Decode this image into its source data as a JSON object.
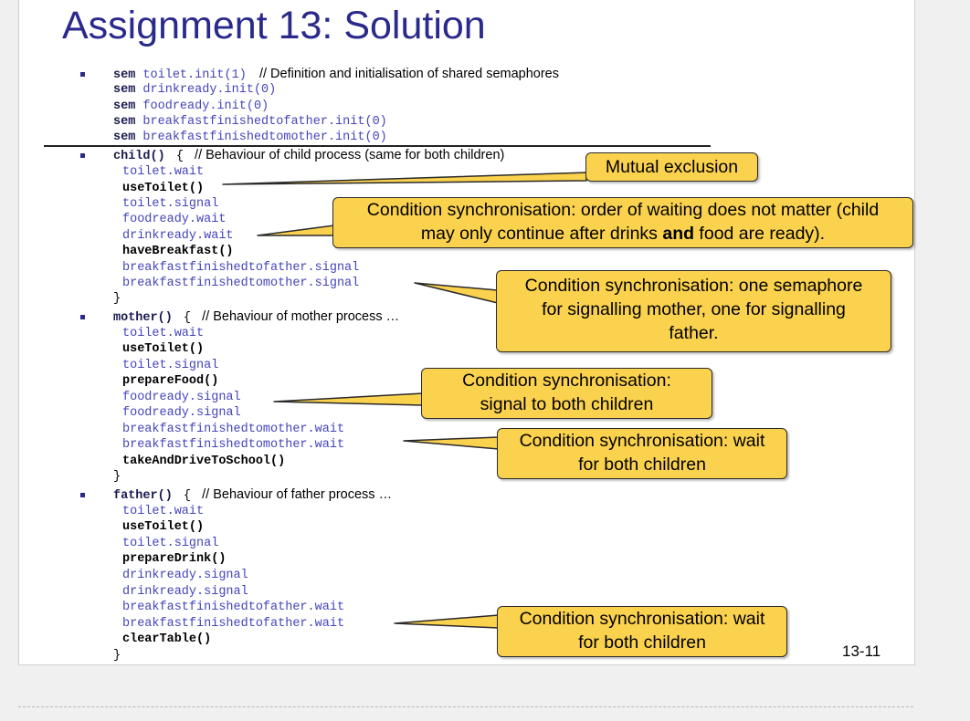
{
  "title": "Assignment 13: Solution",
  "page_number": "13-11",
  "semaphores": {
    "kw": "sem",
    "decl": [
      "toilet.init(1)",
      "drinkready.init(0)",
      "foodready.init(0)",
      "breakfastfinishedtofather.init(0)",
      "breakfastfinishedtomother.init(0)"
    ],
    "comment": "// Definition and initialisation of shared semaphores"
  },
  "child": {
    "header": "child()",
    "brace": "{",
    "comment": "// Behaviour of child process (same for both children)",
    "lines": [
      "toilet.wait",
      "useToilet()",
      "toilet.signal",
      "foodready.wait",
      "drinkready.wait",
      "haveBreakfast()",
      "breakfastfinishedtofather.signal",
      "breakfastfinishedtomother.signal"
    ],
    "close": "}"
  },
  "mother": {
    "header": "mother()",
    "brace": "{",
    "comment": "// Behaviour of mother process …",
    "lines": [
      "toilet.wait",
      "useToilet()",
      "toilet.signal",
      "prepareFood()",
      "foodready.signal",
      "foodready.signal",
      "breakfastfinishedtomother.wait",
      "breakfastfinishedtomother.wait",
      "takeAndDriveToSchool()"
    ],
    "close": "}"
  },
  "father": {
    "header": "father()",
    "brace": "{",
    "comment": "// Behaviour of father process …",
    "lines": [
      "toilet.wait",
      "useToilet()",
      "toilet.signal",
      "prepareDrink()",
      "drinkready.signal",
      "drinkready.signal",
      "breakfastfinishedtofather.wait",
      "breakfastfinishedtofather.wait",
      "clearTable()"
    ],
    "close": "}"
  },
  "callouts": {
    "mutual": "Mutual exclusion",
    "order_a": "Condition synchronisation: order of waiting does not matter (child",
    "order_b": "may only continue after drinks ",
    "order_bold": "and",
    "order_c": " food are ready).",
    "sema_1": "Condition synchronisation: one semaphore",
    "sema_2": "for signalling mother, one for signalling",
    "sema_3": "father.",
    "signal_1": "Condition synchronisation:",
    "signal_2": "signal to both children",
    "wait_m_1": "Condition synchronisation: wait",
    "wait_m_2": "for both children",
    "wait_f_1": "Condition synchronisation: wait",
    "wait_f_2": "for both children"
  },
  "colors": {
    "title": "#2a2a8c",
    "callout_fill": "#fbd24e",
    "code_blue": "#4444bb"
  }
}
